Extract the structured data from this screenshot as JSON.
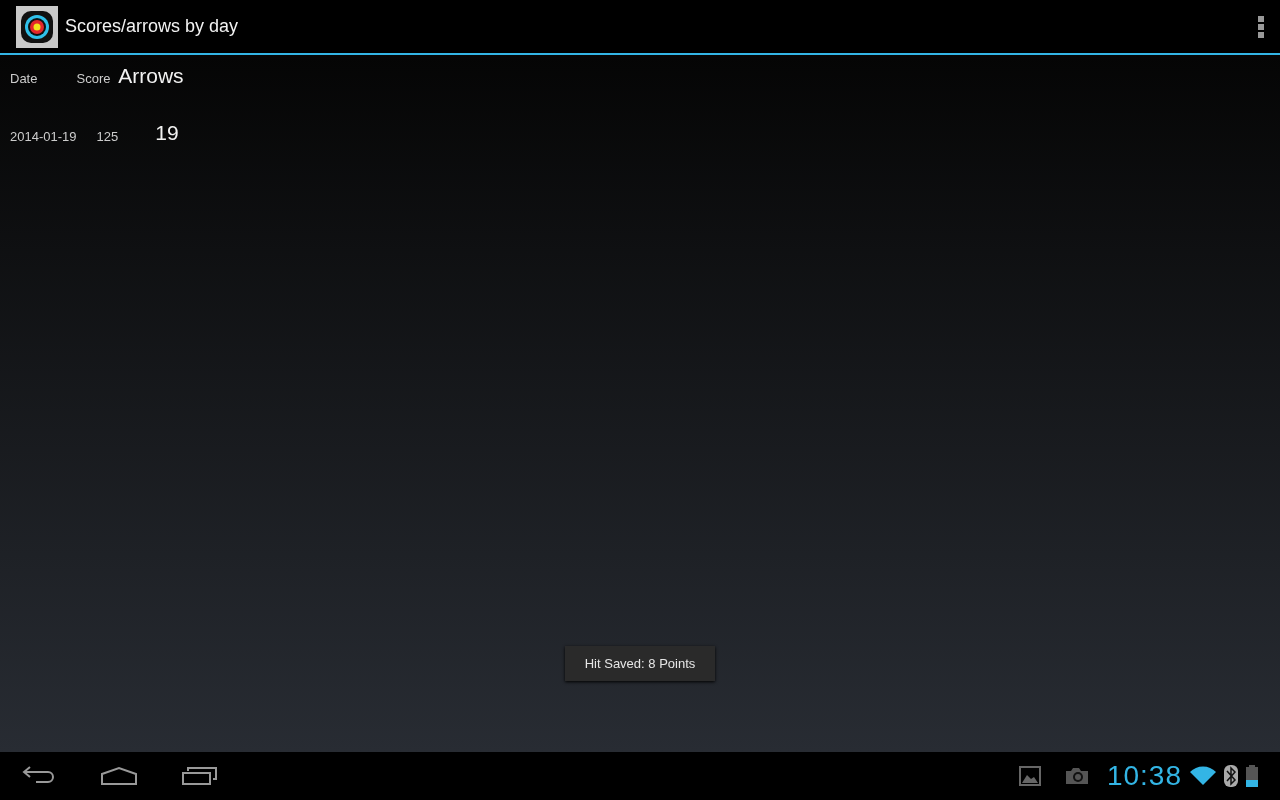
{
  "action_bar": {
    "title": "Scores/arrows by day"
  },
  "table": {
    "columns": [
      "Date",
      "Score",
      "Arrows"
    ],
    "rows": [
      {
        "date": "2014-01-19",
        "score": "125",
        "arrows": "19"
      }
    ]
  },
  "toast": {
    "text": "Hit Saved: 8 Points"
  },
  "status_bar": {
    "time": "10:38"
  }
}
